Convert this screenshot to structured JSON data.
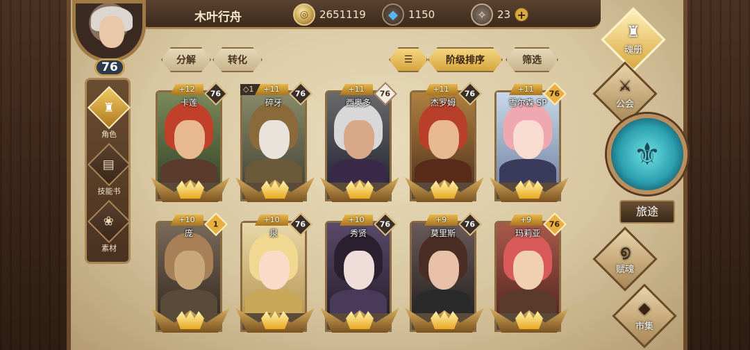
{
  "player": {
    "name": "木叶行舟",
    "level": "76"
  },
  "resources": {
    "gold": "2651119",
    "gems": "1150",
    "crystals": "23"
  },
  "toolbar": {
    "decompose": "分解",
    "convert": "转化",
    "sort_by_tier": "阶级排序",
    "filter": "筛选"
  },
  "left_nav": [
    {
      "label": "角色"
    },
    {
      "label": "技能书"
    },
    {
      "label": "素材"
    }
  ],
  "right_nav": {
    "soul_book": "魂册",
    "guild": "公会",
    "journey": "旅途",
    "soul_grant": "赋魂",
    "market": "市集"
  },
  "heroes": [
    {
      "name": "卡莲",
      "plus": "+12",
      "level": "76"
    },
    {
      "name": "碎牙",
      "plus": "+11",
      "level": "76",
      "extra": "◇1"
    },
    {
      "name": "西奥多",
      "plus": "+11",
      "level": "76"
    },
    {
      "name": "杰罗姆",
      "plus": "+11",
      "level": "76"
    },
    {
      "name": "雪尔森 SP",
      "plus": "+11",
      "level": "76"
    },
    {
      "name": "庞",
      "plus": "+10",
      "level": "1"
    },
    {
      "name": "泉",
      "plus": "+10",
      "level": "76"
    },
    {
      "name": "秀贤",
      "plus": "+10",
      "level": "76"
    },
    {
      "name": "莫里斯",
      "plus": "+9",
      "level": "76"
    },
    {
      "name": "玛莉亚",
      "plus": "+9",
      "level": "76"
    }
  ]
}
